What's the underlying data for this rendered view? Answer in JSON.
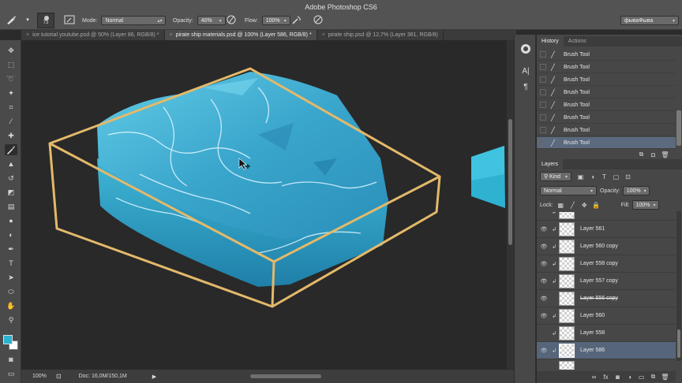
{
  "app_title": "Adobe Photoshop CS6",
  "options": {
    "brush_size": "73",
    "mode_label": "Mode:",
    "mode_value": "Normal",
    "opacity_label": "Opacity:",
    "opacity_value": "40%",
    "flow_label": "Flow:",
    "flow_value": "100%",
    "workspace_value": "фываФыва"
  },
  "tabs": [
    {
      "label": "ice tutorial youtube.psd @ 50% (Layer 86, RGB/8) *",
      "active": false
    },
    {
      "label": "pirate ship materials.psd @ 100% (Layer 586, RGB/8) *",
      "active": true
    },
    {
      "label": "pirate ship.psd @ 12,7% (Layer 361, RGB/8)",
      "active": false
    }
  ],
  "status": {
    "zoom": "100%",
    "doc_info": "Doc: 16,0M/150,1M"
  },
  "history": {
    "tab_history": "History",
    "tab_actions": "Actions",
    "items": [
      "Brush Tool",
      "Brush Tool",
      "Brush Tool",
      "Brush Tool",
      "Brush Tool",
      "Brush Tool",
      "Brush Tool",
      "Brush Tool"
    ]
  },
  "layers": {
    "tab_label": "Layers",
    "kind_label": "Kind",
    "blend_value": "Normal",
    "opacity_label": "Opacity:",
    "opacity_value": "100%",
    "lock_label": "Lock:",
    "fill_label": "Fill:",
    "fill_value": "100%",
    "items": [
      {
        "name": "Layer 561",
        "clipped": true
      },
      {
        "name": "Layer 560 copy",
        "clipped": true
      },
      {
        "name": "Layer 558 copy",
        "clipped": true
      },
      {
        "name": "Layer 557 copy",
        "clipped": true
      },
      {
        "name": "Layer 556 copy",
        "clipped": false
      },
      {
        "name": "Layer 560",
        "clipped": true
      },
      {
        "name": "Layer 558",
        "clipped": true
      },
      {
        "name": "Layer 586",
        "clipped": true
      }
    ]
  },
  "colors": {
    "foreground": "#2ab3cf",
    "background": "#ffffff",
    "guide_box": "#e3b96a",
    "ice_main": "#4cc1de",
    "selection": "#56657a"
  }
}
